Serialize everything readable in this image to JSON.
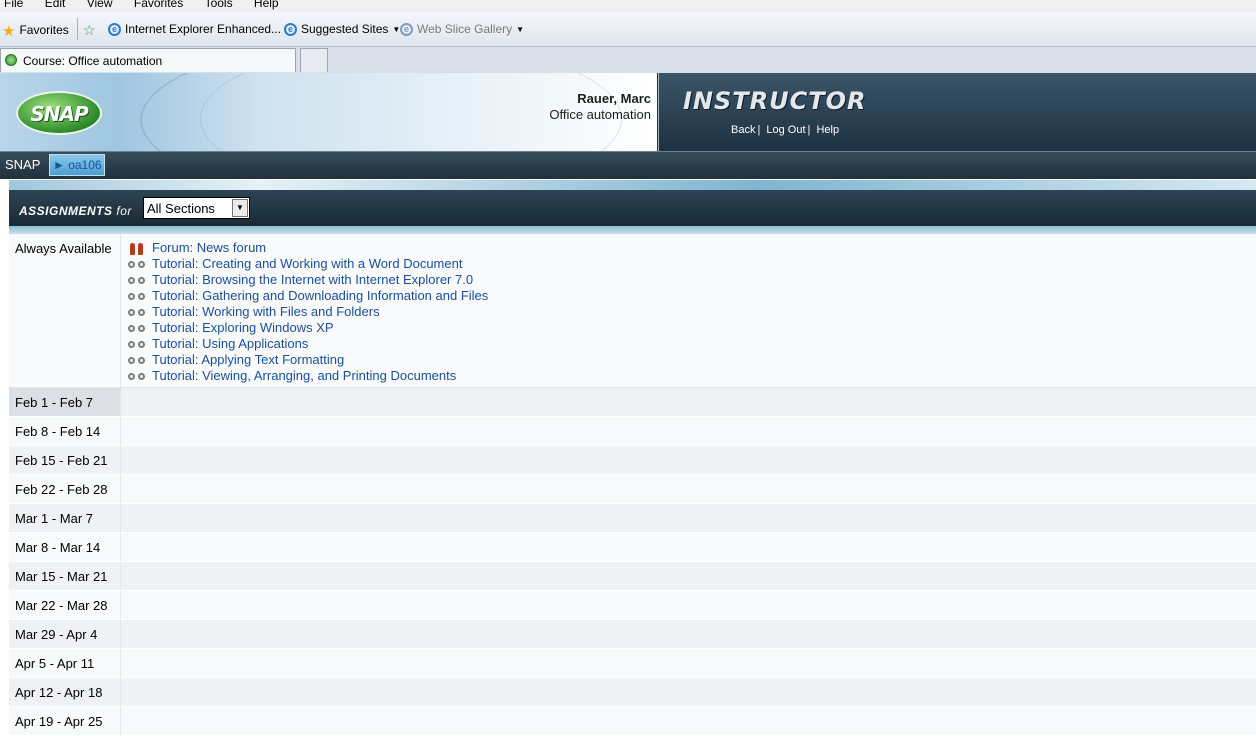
{
  "browser": {
    "menu": [
      "File",
      "Edit",
      "View",
      "Favorites",
      "Tools",
      "Help"
    ],
    "favorites_label": "Favorites",
    "fav_links": [
      {
        "label": "Internet Explorer Enhanced..."
      },
      {
        "label": "Suggested Sites"
      },
      {
        "label": "Web Slice Gallery"
      }
    ],
    "tab_title": "Course: Office automation"
  },
  "header": {
    "logo_text": "SNAP",
    "user_name": "Rauer, Marc",
    "course_name": "Office automation",
    "role": "INSTRUCTOR",
    "links": {
      "back": "Back",
      "logout": "Log Out",
      "help": "Help"
    }
  },
  "breadcrumb": {
    "home": "SNAP",
    "course": "► oa106"
  },
  "assignments": {
    "title": "ASSIGNMENTS",
    "for_label": "for",
    "section_value": "All Sections",
    "always_label": "Always Available",
    "always_items": [
      {
        "icon": "forum-icon",
        "label": "Forum: News forum"
      },
      {
        "icon": "tutorial-icon",
        "label": "Tutorial: Creating and Working with a Word Document"
      },
      {
        "icon": "tutorial-icon",
        "label": "Tutorial: Browsing the Internet with Internet Explorer 7.0"
      },
      {
        "icon": "tutorial-icon",
        "label": "Tutorial: Gathering and Downloading Information and Files"
      },
      {
        "icon": "tutorial-icon",
        "label": "Tutorial: Working with Files and Folders"
      },
      {
        "icon": "tutorial-icon",
        "label": "Tutorial: Exploring Windows XP"
      },
      {
        "icon": "tutorial-icon",
        "label": "Tutorial: Using Applications"
      },
      {
        "icon": "tutorial-icon",
        "label": "Tutorial: Applying Text Formatting"
      },
      {
        "icon": "tutorial-icon",
        "label": "Tutorial: Viewing, Arranging, and Printing Documents"
      }
    ],
    "weeks": [
      "Feb 1 - Feb 7",
      "Feb 8 - Feb 14",
      "Feb 15 - Feb 21",
      "Feb 22 - Feb 28",
      "Mar 1 - Mar 7",
      "Mar 8 - Mar 14",
      "Mar 15 - Mar 21",
      "Mar 22 - Mar 28",
      "Mar 29 - Apr 4",
      "Apr 5 - Apr 11",
      "Apr 12 - Apr 18",
      "Apr 19 - Apr 25"
    ]
  }
}
